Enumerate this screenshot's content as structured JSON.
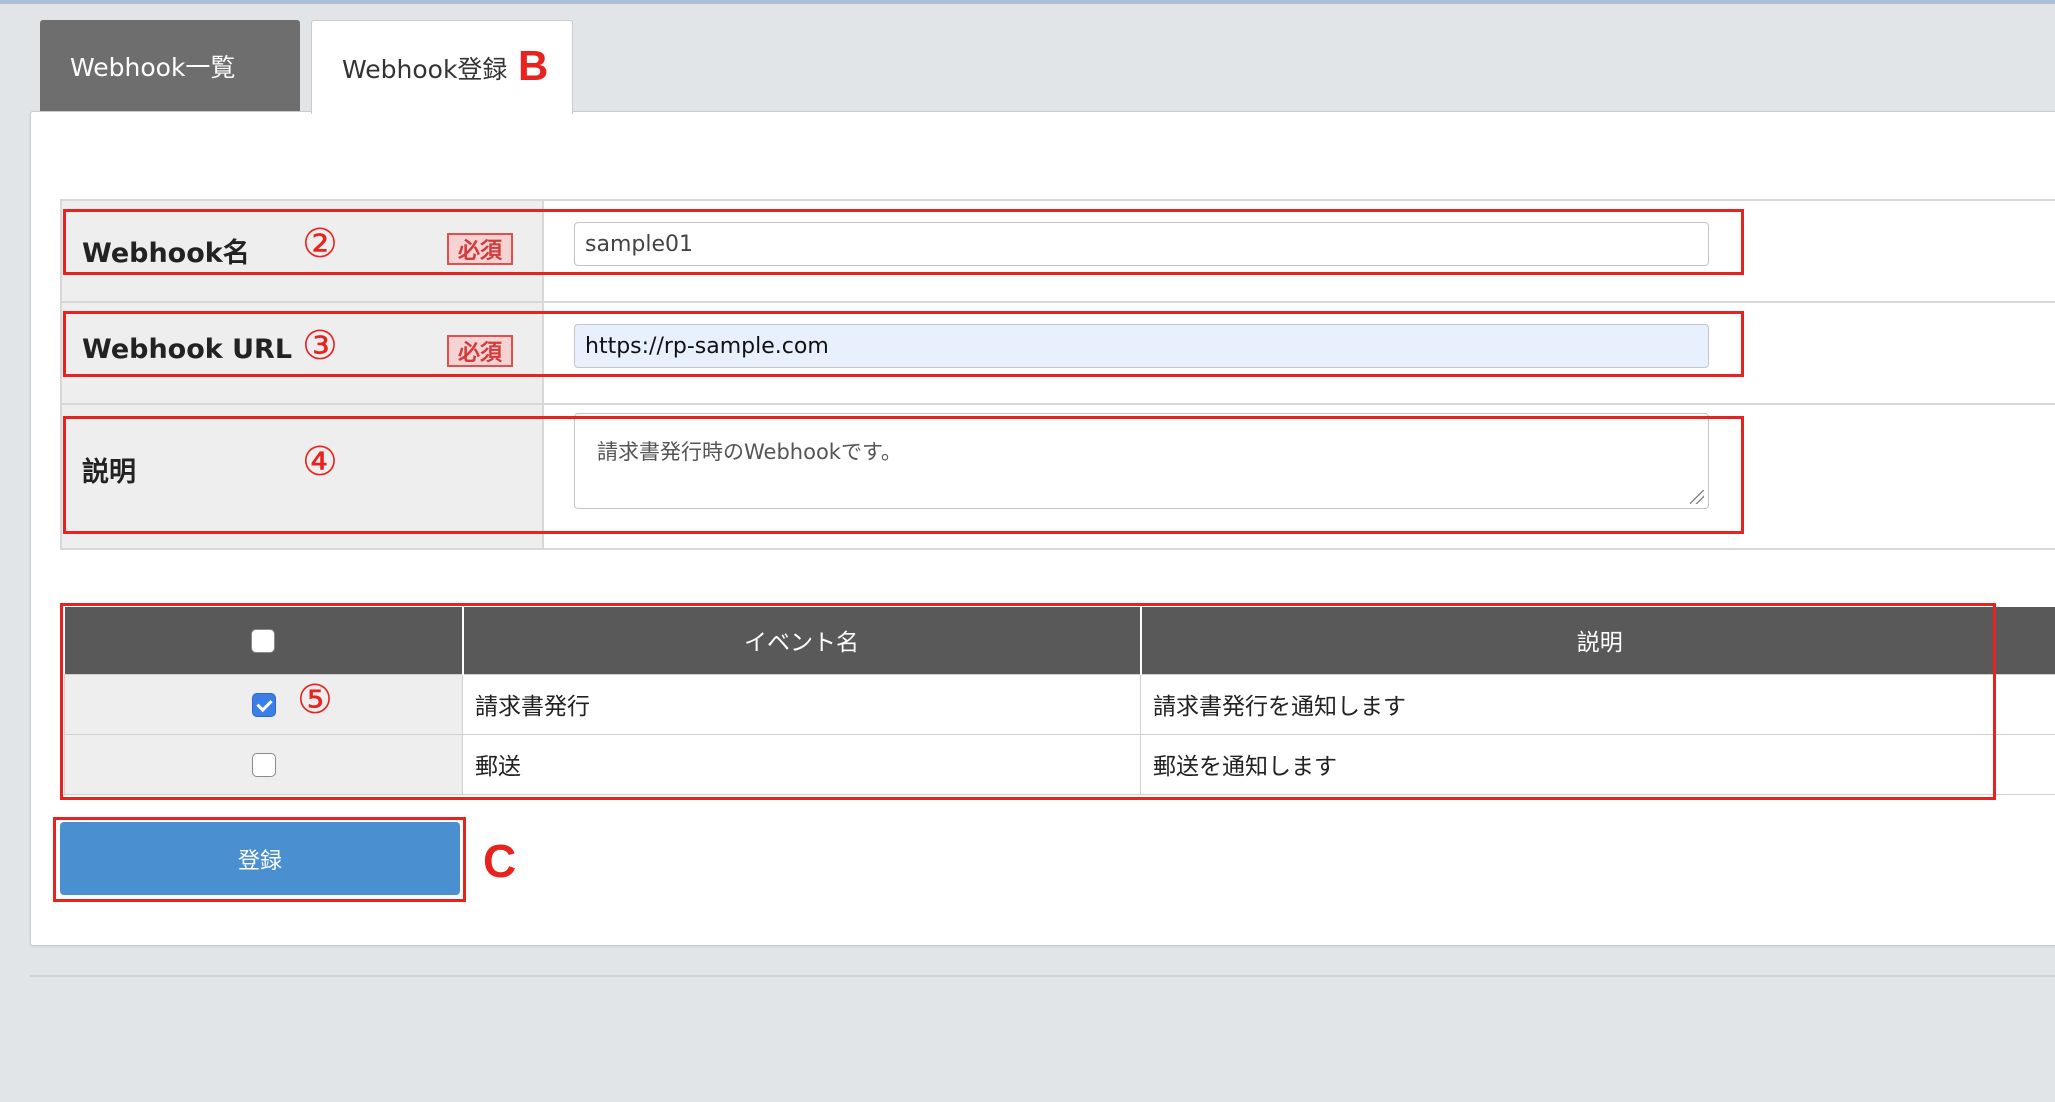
{
  "tabs": [
    {
      "label": "Webhook一覧",
      "active": false
    },
    {
      "label": "Webhook登録",
      "active": true
    }
  ],
  "markers": {
    "b": "B",
    "c": "C"
  },
  "form": {
    "name": {
      "label": "Webhook名",
      "number": "②",
      "required": "必須",
      "value": "sample01"
    },
    "url": {
      "label": "Webhook URL",
      "number": "③",
      "required": "必須",
      "value": "https://rp-sample.com"
    },
    "description": {
      "label": "説明",
      "number": "④",
      "value": "請求書発行時のWebhookです。"
    }
  },
  "events": {
    "headers": [
      "イベント名",
      "説明"
    ],
    "number": "⑤",
    "rows": [
      {
        "checked": true,
        "name": "請求書発行",
        "description": "請求書発行を通知します"
      },
      {
        "checked": false,
        "name": "郵送",
        "description": "郵送を通知します"
      }
    ]
  },
  "submit_label": "登録",
  "colors": {
    "accent": "#4a8fd0",
    "annotation": "#e8231f",
    "header_bg": "#595959"
  }
}
